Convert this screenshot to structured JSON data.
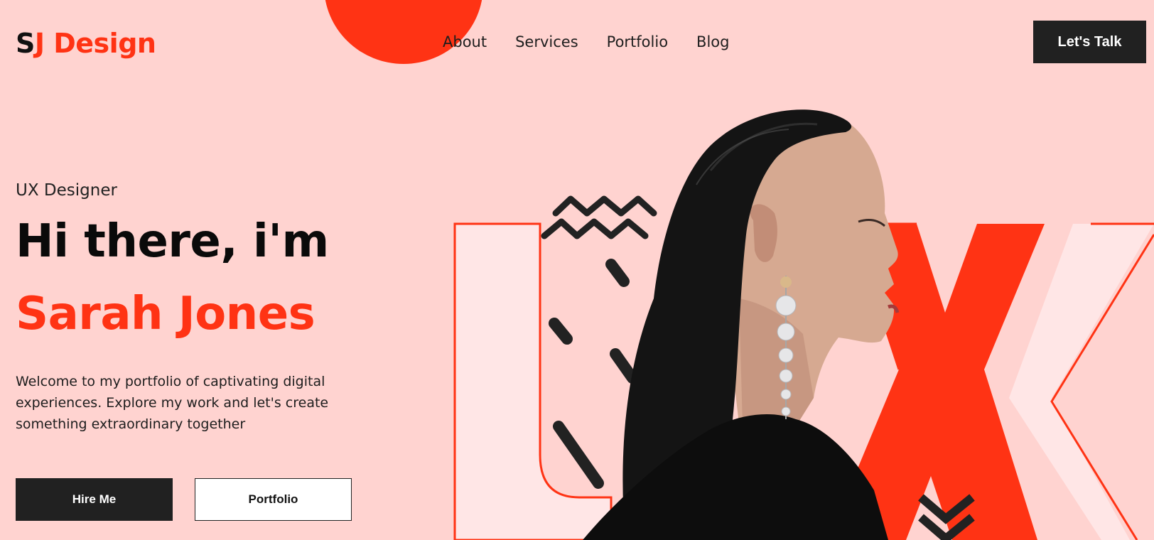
{
  "brand": {
    "logo_first": "S",
    "logo_rest": "J Design",
    "accent": "#FF3314",
    "dark": "#212121",
    "background": "#FFD3D0"
  },
  "nav": {
    "items": [
      {
        "label": "About"
      },
      {
        "label": "Services"
      },
      {
        "label": "Portfolio"
      },
      {
        "label": "Blog"
      }
    ],
    "cta_label": "Let's Talk"
  },
  "hero": {
    "role": "UX Designer",
    "greeting": "Hi there, i'm",
    "name": "Sarah Jones",
    "intro": "Welcome to my portfolio of captivating digital experiences. Explore my work and let's create something extraordinary together",
    "hire_label": "Hire Me",
    "portfolio_label": "Portfolio"
  },
  "art": {
    "letters": "UX",
    "portrait_icon": "woman-profile-portrait",
    "earring_icon": "pearl-drop-earring"
  }
}
